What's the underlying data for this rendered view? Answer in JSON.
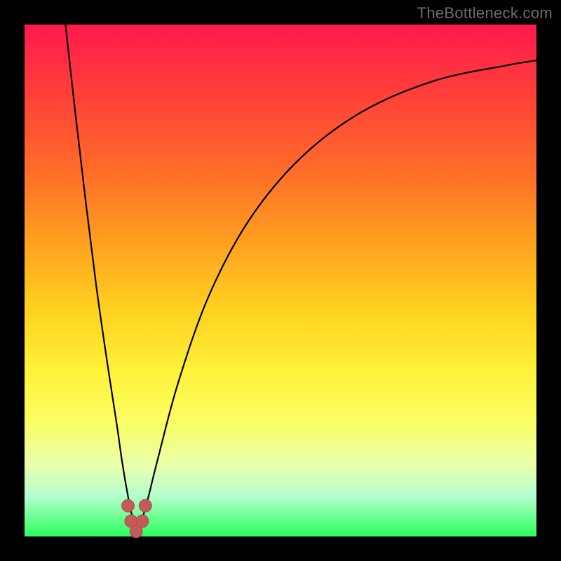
{
  "watermark": "TheBottleneck.com",
  "colors": {
    "frame": "#000000",
    "curve": "#000000",
    "marker_fill": "#c45a5a",
    "marker_stroke": "#b24d4d"
  },
  "chart_data": {
    "type": "line",
    "title": "",
    "xlabel": "",
    "ylabel": "",
    "xlim": [
      0,
      100
    ],
    "ylim": [
      0,
      100
    ],
    "note": "No axes, ticks, or numeric labels are visible. V-shaped bottleneck curve with minimum near x≈22, y≈0. Values are visual estimates on a 0–100 normalized grid.",
    "series": [
      {
        "name": "left-branch",
        "x": [
          8,
          10,
          12,
          14,
          16,
          18,
          19,
          20,
          21,
          22
        ],
        "y": [
          100,
          82,
          65,
          49,
          35,
          22,
          15,
          9,
          4,
          0
        ]
      },
      {
        "name": "right-branch",
        "x": [
          22,
          24,
          26,
          30,
          36,
          44,
          54,
          66,
          80,
          94,
          100
        ],
        "y": [
          0,
          7,
          15,
          30,
          47,
          62,
          74,
          83,
          89,
          92,
          93
        ]
      }
    ],
    "markers": {
      "name": "valley-points",
      "x": [
        20.2,
        20.8,
        21.8,
        23.0,
        23.6
      ],
      "y": [
        6.0,
        3.0,
        1.0,
        3.0,
        6.0
      ]
    }
  }
}
